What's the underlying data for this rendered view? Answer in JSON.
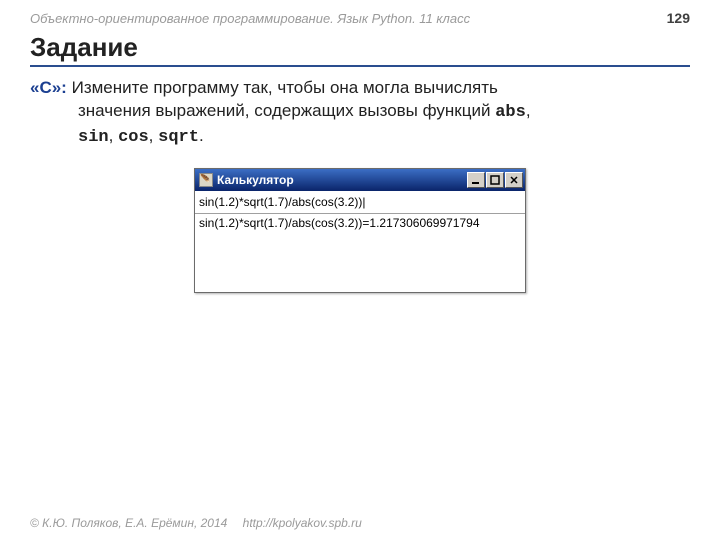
{
  "header": {
    "course": "Объектно-ориентированное программирование. Язык Python. 11 класс",
    "page": "129"
  },
  "title": "Задание",
  "task": {
    "level": "«C»:",
    "line1": "Измените программу так, чтобы она могла вычислять",
    "line2_a": "значения выражений, содержащих вызовы функций ",
    "abs": "abs",
    "line2_b": ", ",
    "sin": "sin",
    "line2_c": ", ",
    "cos": "cos",
    "line2_d": ", ",
    "sqrt": "sqrt",
    "line2_e": "."
  },
  "win": {
    "icon_glyph": "🪶",
    "title": "Калькулятор",
    "input_value": "sin(1.2)*sqrt(1.7)/abs(cos(3.2))|",
    "output": "sin(1.2)*sqrt(1.7)/abs(cos(3.2))=1.217306069971794"
  },
  "footer": {
    "copyright": "© К.Ю. Поляков, Е.А. Ерёмин, 2014",
    "url": "http://kpolyakov.spb.ru"
  }
}
